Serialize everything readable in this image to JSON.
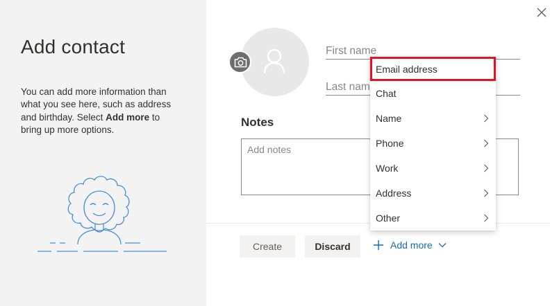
{
  "dialog": {
    "title": "Add contact",
    "info_pre": "You can add more information than what you see here, such as address and birthday. Select ",
    "info_bold": "Add more",
    "info_post": " to bring up more options."
  },
  "form": {
    "first_name_placeholder": "First name",
    "last_name_placeholder": "Last name",
    "notes_label": "Notes",
    "notes_placeholder": "Add notes"
  },
  "actions": {
    "create_label": "Create",
    "discard_label": "Discard",
    "add_more_label": "Add more"
  },
  "menu": {
    "items": [
      {
        "label": "Email address",
        "submenu": false,
        "highlighted": true
      },
      {
        "label": "Chat",
        "submenu": false
      },
      {
        "label": "Name",
        "submenu": true
      },
      {
        "label": "Phone",
        "submenu": true
      },
      {
        "label": "Work",
        "submenu": true
      },
      {
        "label": "Address",
        "submenu": true
      },
      {
        "label": "Other",
        "submenu": true
      }
    ]
  },
  "icons": {
    "close": "close-icon",
    "camera": "camera-icon",
    "avatar": "person-icon",
    "plus": "plus-icon",
    "chevron": "chevron-down-icon"
  },
  "colors": {
    "accent": "#0f6cbd",
    "highlight_border": "#e81123",
    "left_panel_bg": "#f3f3f3",
    "illustration": "#4a8fd0"
  }
}
